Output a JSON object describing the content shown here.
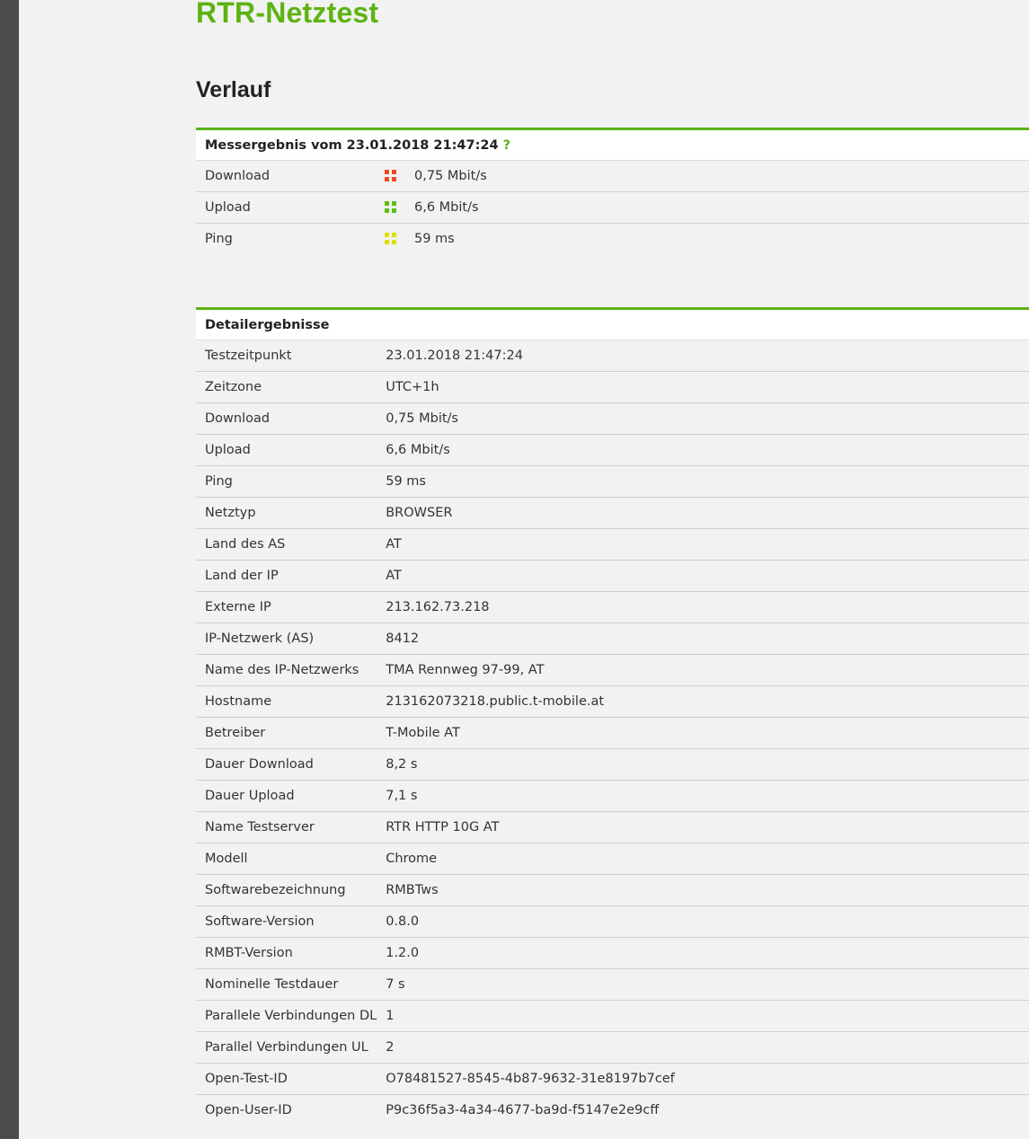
{
  "site_title": "RTR-Netztest",
  "page_heading": "Verlauf",
  "summary": {
    "header_prefix": "Messergebnis vom 23.01.2018 21:47:24",
    "help_mark": "?",
    "rows": [
      {
        "label": "Download",
        "value": "0,75 Mbit/s",
        "icon": "classification-red-icon",
        "color": "#f04a1e"
      },
      {
        "label": "Upload",
        "value": "6,6 Mbit/s",
        "icon": "classification-green-icon",
        "color": "#5cbf14"
      },
      {
        "label": "Ping",
        "value": "59 ms",
        "icon": "classification-yellow-icon",
        "color": "#dede00"
      }
    ]
  },
  "details": {
    "header": "Detailergebnisse",
    "rows": [
      {
        "label": "Testzeitpunkt",
        "value": "23.01.2018 21:47:24"
      },
      {
        "label": "Zeitzone",
        "value": "UTC+1h"
      },
      {
        "label": "Download",
        "value": "0,75 Mbit/s"
      },
      {
        "label": "Upload",
        "value": "6,6 Mbit/s"
      },
      {
        "label": "Ping",
        "value": "59 ms"
      },
      {
        "label": "Netztyp",
        "value": "BROWSER"
      },
      {
        "label": "Land des AS",
        "value": "AT"
      },
      {
        "label": "Land der IP",
        "value": "AT"
      },
      {
        "label": "Externe IP",
        "value": "213.162.73.218"
      },
      {
        "label": "IP-Netzwerk (AS)",
        "value": "8412"
      },
      {
        "label": "Name des IP-Netzwerks",
        "value": "TMA Rennweg 97-99, AT"
      },
      {
        "label": "Hostname",
        "value": "213162073218.public.t-mobile.at"
      },
      {
        "label": "Betreiber",
        "value": "T-Mobile AT"
      },
      {
        "label": "Dauer Download",
        "value": "8,2 s"
      },
      {
        "label": "Dauer Upload",
        "value": "7,1 s"
      },
      {
        "label": "Name Testserver",
        "value": "RTR HTTP 10G AT"
      },
      {
        "label": "Modell",
        "value": "Chrome"
      },
      {
        "label": "Softwarebezeichnung",
        "value": "RMBTws"
      },
      {
        "label": "Software-Version",
        "value": "0.8.0"
      },
      {
        "label": "RMBT-Version",
        "value": "1.2.0"
      },
      {
        "label": "Nominelle Testdauer",
        "value": "7 s"
      },
      {
        "label": "Parallele Verbindungen DL",
        "value": "1"
      },
      {
        "label": "Parallel Verbindungen UL",
        "value": "2"
      },
      {
        "label": "Open-Test-ID",
        "value": "O78481527-8545-4b87-9632-31e8197b7cef"
      },
      {
        "label": "Open-User-ID",
        "value": "P9c36f5a3-4a34-4677-ba9d-f5147e2e9cff"
      }
    ]
  }
}
